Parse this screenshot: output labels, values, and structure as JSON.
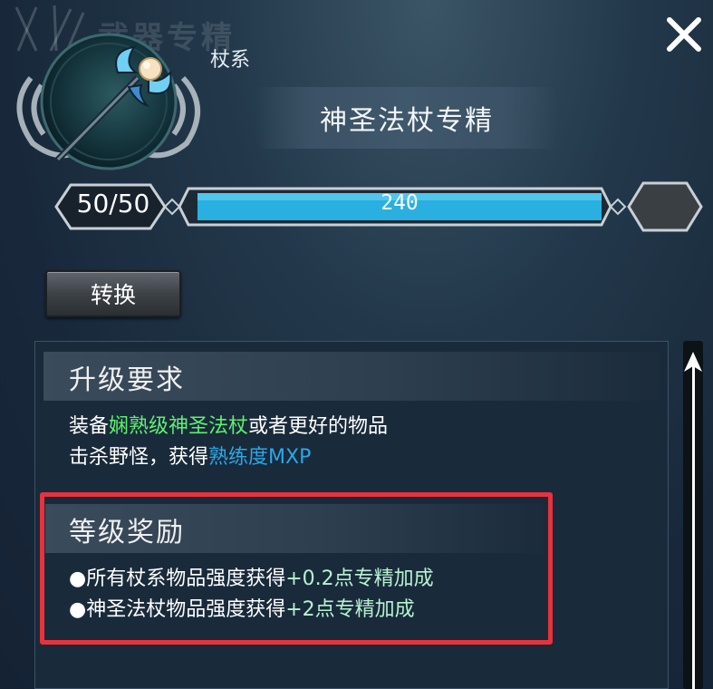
{
  "header": {
    "ghost_title": "武器专精",
    "category": "杖系",
    "skill_name": "神圣法杖专精"
  },
  "level": {
    "current": "50/50",
    "exp_value": "240",
    "exp_fill": 1.0
  },
  "buttons": {
    "convert": "转换"
  },
  "requirements": {
    "title": "升级要求",
    "line1_prefix": "装备",
    "line1_item": "娴熟级神圣法杖",
    "line1_suffix": "或者更好的物品",
    "line2_prefix": "击杀野怪，获得",
    "line2_keyword": "熟练度MXP"
  },
  "rewards": {
    "title": "等级奖励",
    "items": [
      {
        "bullet": "●",
        "text": "所有杖系物品强度获得",
        "bonus": "+0.2点专精加成"
      },
      {
        "bullet": "●",
        "text": "神圣法杖物品强度获得",
        "bonus": "+2点专精加成"
      }
    ]
  },
  "colors": {
    "highlight_border": "#e8323c",
    "exp_bar": "#2ab0e0",
    "item_green": "#5ef06e",
    "keyword_blue": "#2aa8e8"
  },
  "icons": [
    "close-icon",
    "staff-icon",
    "scroll-up-arrow-icon"
  ]
}
